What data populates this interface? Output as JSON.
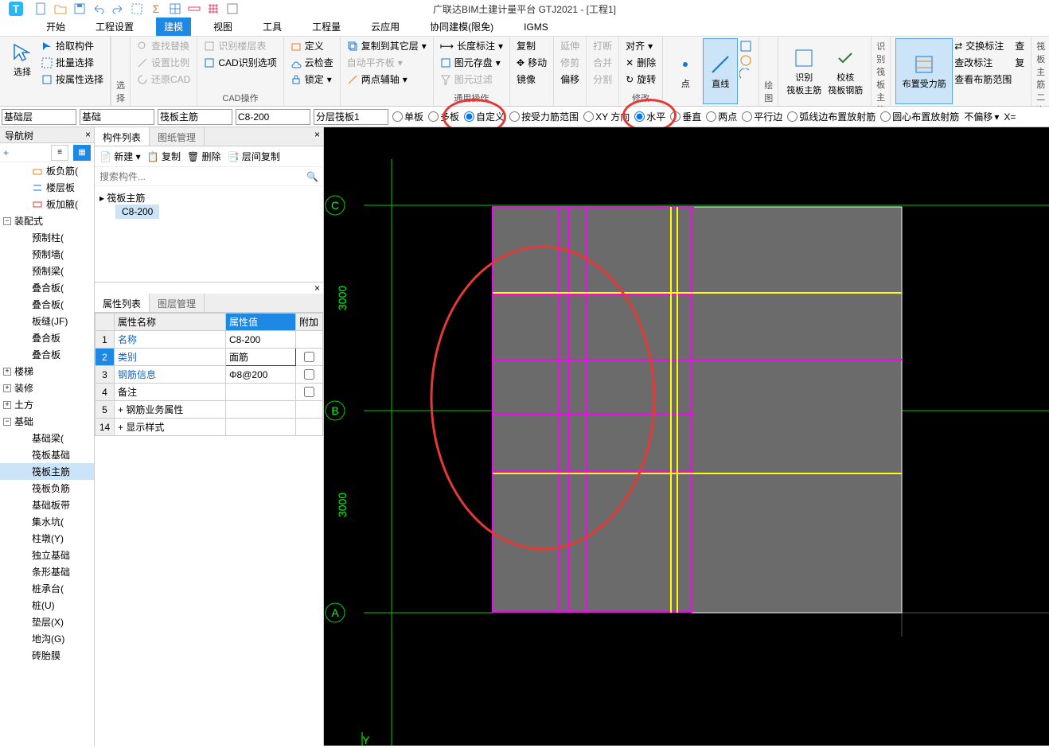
{
  "title": "广联达BIM土建计量平台 GTJ2021 - [工程1]",
  "menu": {
    "start": "开始",
    "settings": "工程设置",
    "model": "建模",
    "view": "视图",
    "tool": "工具",
    "qty": "工程量",
    "cloud": "云应用",
    "collab": "协同建模(限免)",
    "igms": "IGMS"
  },
  "ribbon": {
    "select": {
      "big": "选择",
      "pick": "拾取构件",
      "batch": "批量选择",
      "byprop": "按属性选择",
      "label": "选择"
    },
    "cad": {
      "find": "查找替换",
      "scale": "设置比例",
      "restore": "还原CAD",
      "floor": "识别楼层表",
      "cadopt": "CAD识别选项",
      "label": "CAD操作"
    },
    "common": {
      "define": "定义",
      "cloudcheck": "云检查",
      "lock": "锁定",
      "copyto": "复制到其它层",
      "autoalign": "自动平齐板",
      "twopoint": "两点辅轴",
      "len": "长度标注",
      "save": "图元存盘",
      "filter": "图元过滤",
      "label": "通用操作"
    },
    "modify": {
      "copy": "复制",
      "move": "移动",
      "mirror": "镜像",
      "extend": "延伸",
      "trim": "修剪",
      "offset": "偏移",
      "break": "打断",
      "merge": "合并",
      "split": "分割",
      "align": "对齐",
      "delete": "删除",
      "rotate": "旋转",
      "label": "修改"
    },
    "draw": {
      "point": "点",
      "line": "直线",
      "label": "绘图"
    },
    "recog": {
      "main": "识别\n筏板主筋",
      "check": "校核\n筏板钢筋",
      "label": "识别筏板主筋"
    },
    "place": {
      "btn": "布置受力筋",
      "swap": "交换标注",
      "modify": "查改标注",
      "range": "查看布筋范围",
      "label": "筏板主筋二次编辑",
      "more1": "查",
      "more2": "复"
    }
  },
  "optbar": {
    "d1": "基础层",
    "d2": "基础",
    "d3": "筏板主筋",
    "d4": "C8-200",
    "d5": "分层筏板1",
    "r1": "单板",
    "r2": "多板",
    "r3": "自定义",
    "r4": "按受力筋范围",
    "r5": "XY 方向",
    "r6": "水平",
    "r7": "垂直",
    "r8": "两点",
    "r9": "平行边",
    "r10": "弧线边布置放射筋",
    "r11": "圆心布置放射筋",
    "r12": "不偏移",
    "r13": "X="
  },
  "nav": {
    "title": "导航树",
    "items": {
      "bfj": "板负筋(",
      "lcb": "楼层板",
      "bjf": "板加腋(",
      "zps": "装配式",
      "yzz": "预制柱(",
      "yzq": "预制墙(",
      "yzl": "预制梁(",
      "dhb1": "叠合板(",
      "dhb2": "叠合板(",
      "bf": "板缝(JF)",
      "dhb3": "叠合板",
      "dhb4": "叠合板",
      "lt": "楼梯",
      "zx": "装修",
      "tf": "土方",
      "jc": "基础",
      "jcl": "基础梁(",
      "fbjc": "筏板基础",
      "fbzj": "筏板主筋",
      "fbfj": "筏板负筋",
      "jcbd": "基础板带",
      "jsk": "集水坑(",
      "zd": "柱墩(Y)",
      "dljc": "独立基础",
      "txjc": "条形基础",
      "zct": "桩承台(",
      "zhu": "桩(U)",
      "dc": "垫层(X)",
      "dg": "地沟(G)",
      "last": "砖胎膜"
    }
  },
  "comp": {
    "tab1": "构件列表",
    "tab2": "图纸管理",
    "new": "新建",
    "copy": "复制",
    "del": "删除",
    "layercopy": "层间复制",
    "searchph": "搜索构件...",
    "grp": "筏板主筋",
    "item": "C8-200"
  },
  "prop": {
    "tab1": "属性列表",
    "tab2": "图层管理",
    "h1": "属性名称",
    "h2": "属性值",
    "h3": "附加",
    "r1n": "名称",
    "r1v": "C8-200",
    "r2n": "类别",
    "r2v": "面筋",
    "r3n": "钢筋信息",
    "r3v": "Φ8@200",
    "r4n": "备注",
    "r5n": "钢筋业务属性",
    "r14n": "显示样式"
  },
  "axes": {
    "a": "A",
    "b": "B",
    "c": "C",
    "d1": "3000",
    "d2": "3000",
    "y": "Y"
  }
}
